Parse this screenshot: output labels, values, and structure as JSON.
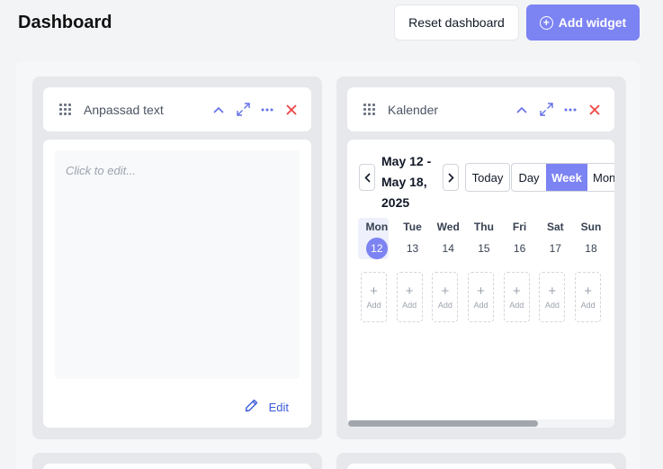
{
  "header": {
    "title": "Dashboard",
    "reset_label": "Reset dashboard",
    "add_label": "Add widget"
  },
  "widgets": [
    {
      "title": "Anpassad text",
      "placeholder": "Click to edit...",
      "edit_label": "Edit"
    },
    {
      "title": "Kalender",
      "range": "May 12 - May 18, 2025",
      "today_label": "Today",
      "views": [
        "Day",
        "Week",
        "Mon"
      ],
      "active_view": "Week",
      "days": [
        {
          "name": "Mon",
          "num": "12",
          "today": true
        },
        {
          "name": "Tue",
          "num": "13"
        },
        {
          "name": "Wed",
          "num": "14"
        },
        {
          "name": "Thu",
          "num": "15"
        },
        {
          "name": "Fri",
          "num": "16"
        },
        {
          "name": "Sat",
          "num": "17"
        },
        {
          "name": "Sun",
          "num": "18"
        }
      ],
      "add_label": "Add"
    }
  ],
  "colors": {
    "accent": "#7c83f2",
    "close": "#ef4444",
    "tool": "#6370e8",
    "link": "#3b5bdb"
  },
  "icons": [
    "drag-handle-icon",
    "chevron-up-icon",
    "expand-icon",
    "more-icon",
    "close-icon",
    "pencil-icon",
    "plus-circle-icon",
    "chevron-left-icon",
    "chevron-right-icon"
  ]
}
